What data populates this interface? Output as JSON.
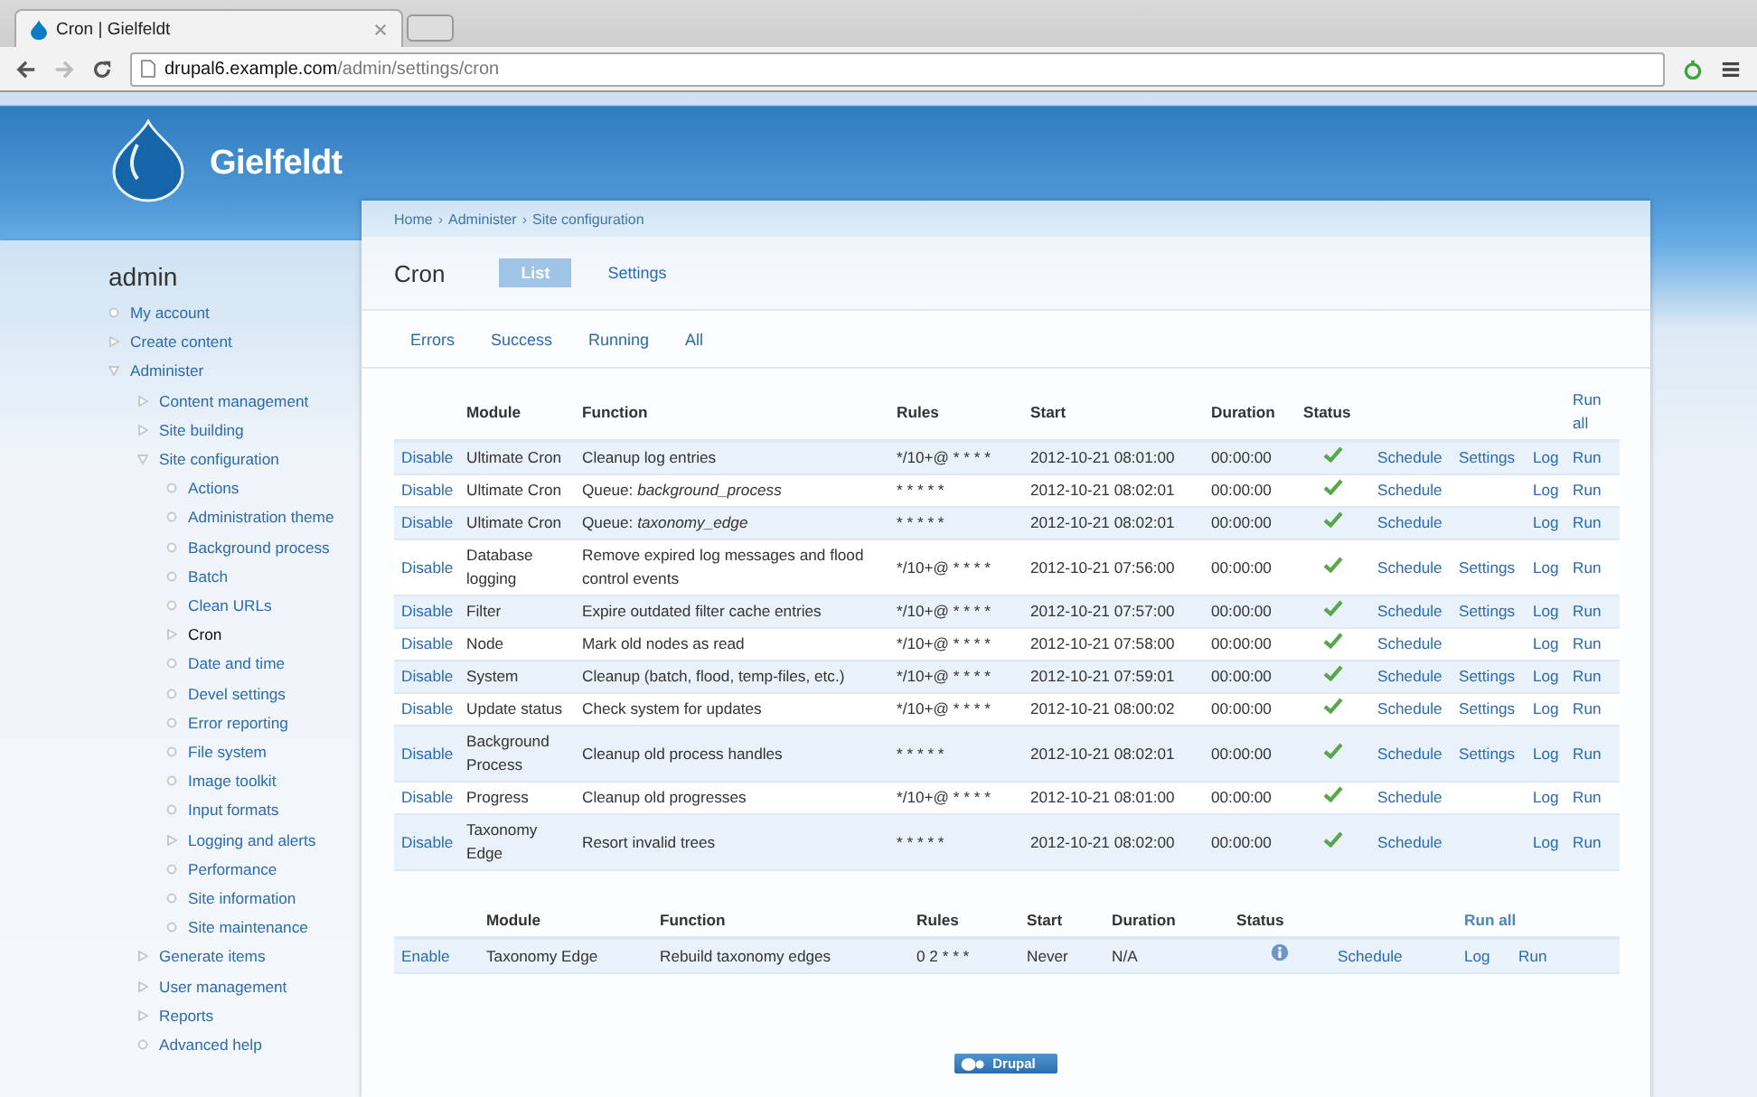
{
  "browser": {
    "tab_title": "Cron | Gielfeldt",
    "url_host": "drupal6.example.com",
    "url_path": "/admin/settings/cron"
  },
  "site_name": "Gielfeldt",
  "breadcrumb": {
    "separator": "›",
    "items": [
      "Home",
      "Administer",
      "Site configuration"
    ]
  },
  "sidebar": {
    "user": "admin",
    "items": [
      {
        "label": "My account",
        "kind": "leaf",
        "selected": false
      },
      {
        "label": "Create content",
        "kind": "branch",
        "expanded": false,
        "selected": false
      },
      {
        "label": "Administer",
        "kind": "branch",
        "expanded": true,
        "selected": false,
        "children": [
          {
            "label": "Content management",
            "kind": "branch",
            "expanded": false,
            "selected": false
          },
          {
            "label": "Site building",
            "kind": "branch",
            "expanded": false,
            "selected": false
          },
          {
            "label": "Site configuration",
            "kind": "branch",
            "expanded": true,
            "selected": false,
            "children": [
              {
                "label": "Actions",
                "kind": "leaf",
                "selected": false
              },
              {
                "label": "Administration theme",
                "kind": "leaf",
                "selected": false
              },
              {
                "label": "Background process",
                "kind": "leaf",
                "selected": false
              },
              {
                "label": "Batch",
                "kind": "leaf",
                "selected": false
              },
              {
                "label": "Clean URLs",
                "kind": "leaf",
                "selected": false
              },
              {
                "label": "Cron",
                "kind": "branch",
                "expanded": false,
                "selected": true
              },
              {
                "label": "Date and time",
                "kind": "leaf",
                "selected": false
              },
              {
                "label": "Devel settings",
                "kind": "leaf",
                "selected": false
              },
              {
                "label": "Error reporting",
                "kind": "leaf",
                "selected": false
              },
              {
                "label": "File system",
                "kind": "leaf",
                "selected": false
              },
              {
                "label": "Image toolkit",
                "kind": "leaf",
                "selected": false
              },
              {
                "label": "Input formats",
                "kind": "leaf",
                "selected": false
              },
              {
                "label": "Logging and alerts",
                "kind": "branch",
                "expanded": false,
                "selected": false
              },
              {
                "label": "Performance",
                "kind": "leaf",
                "selected": false
              },
              {
                "label": "Site information",
                "kind": "leaf",
                "selected": false
              },
              {
                "label": "Site maintenance",
                "kind": "leaf",
                "selected": false
              }
            ]
          },
          {
            "label": "Generate items",
            "kind": "branch",
            "expanded": false,
            "selected": false
          },
          {
            "label": "User management",
            "kind": "branch",
            "expanded": false,
            "selected": false
          },
          {
            "label": "Reports",
            "kind": "branch",
            "expanded": false,
            "selected": false
          },
          {
            "label": "Advanced help",
            "kind": "leaf",
            "selected": false
          }
        ]
      }
    ]
  },
  "page_title": "Cron",
  "tabs": [
    {
      "label": "List",
      "selected": true
    },
    {
      "label": "Settings",
      "selected": false
    }
  ],
  "subtabs": [
    {
      "label": "Errors",
      "selected": false
    },
    {
      "label": "Success",
      "selected": false
    },
    {
      "label": "Running",
      "selected": false
    },
    {
      "label": "All",
      "selected": false
    }
  ],
  "jobs_table": {
    "columns": [
      "Module",
      "Function",
      "Rules",
      "Start",
      "Duration",
      "Status"
    ],
    "run_all": "Run all",
    "rows": [
      {
        "action": "Disable",
        "module": "Ultimate Cron",
        "function": "Cleanup log entries",
        "rules": "*/10+@ * * * *",
        "start": "2012-10-21 08:01:00",
        "duration": "00:00:00",
        "kind": "ok",
        "schedule": "Schedule",
        "settings": "Settings",
        "log": "Log",
        "run": "Run"
      },
      {
        "action": "Disable",
        "module": "Ultimate Cron",
        "function": "Queue: *background_process*",
        "rules": "* * * * *",
        "start": "2012-10-21 08:02:01",
        "duration": "00:00:00",
        "kind": "ok",
        "schedule": "Schedule",
        "log": "Log",
        "run": "Run"
      },
      {
        "action": "Disable",
        "module": "Ultimate Cron",
        "function": "Queue: *taxonomy_edge*",
        "rules": "* * * * *",
        "start": "2012-10-21 08:02:01",
        "duration": "00:00:00",
        "kind": "ok",
        "schedule": "Schedule",
        "log": "Log",
        "run": "Run"
      },
      {
        "action": "Disable",
        "module": "Database logging",
        "function": "Remove expired log messages and flood control events",
        "rules": "*/10+@ * * * *",
        "start": "2012-10-21 07:56:00",
        "duration": "00:00:00",
        "kind": "ok",
        "schedule": "Schedule",
        "settings": "Settings",
        "log": "Log",
        "run": "Run"
      },
      {
        "action": "Disable",
        "module": "Filter",
        "function": "Expire outdated filter cache entries",
        "rules": "*/10+@ * * * *",
        "start": "2012-10-21 07:57:00",
        "duration": "00:00:00",
        "kind": "ok",
        "schedule": "Schedule",
        "settings": "Settings",
        "log": "Log",
        "run": "Run"
      },
      {
        "action": "Disable",
        "module": "Node",
        "function": "Mark old nodes as read",
        "rules": "*/10+@ * * * *",
        "start": "2012-10-21 07:58:00",
        "duration": "00:00:00",
        "kind": "ok",
        "schedule": "Schedule",
        "log": "Log",
        "run": "Run"
      },
      {
        "action": "Disable",
        "module": "System",
        "function": "Cleanup (batch, flood, temp-files, etc.)",
        "rules": "*/10+@ * * * *",
        "start": "2012-10-21 07:59:01",
        "duration": "00:00:00",
        "kind": "ok",
        "schedule": "Schedule",
        "settings": "Settings",
        "log": "Log",
        "run": "Run"
      },
      {
        "action": "Disable",
        "module": "Update status",
        "function": "Check system for updates",
        "rules": "*/10+@ * * * *",
        "start": "2012-10-21 08:00:02",
        "duration": "00:00:00",
        "kind": "ok",
        "schedule": "Schedule",
        "settings": "Settings",
        "log": "Log",
        "run": "Run"
      },
      {
        "action": "Disable",
        "module": "Background Process",
        "function": "Cleanup old process handles",
        "rules": "* * * * *",
        "start": "2012-10-21 08:02:01",
        "duration": "00:00:00",
        "kind": "ok",
        "schedule": "Schedule",
        "settings": "Settings",
        "log": "Log",
        "run": "Run"
      },
      {
        "action": "Disable",
        "module": "Progress",
        "function": "Cleanup old progresses",
        "rules": "*/10+@ * * * *",
        "start": "2012-10-21 08:01:00",
        "duration": "00:00:00",
        "kind": "ok",
        "schedule": "Schedule",
        "log": "Log",
        "run": "Run"
      },
      {
        "action": "Disable",
        "module": "Taxonomy Edge",
        "function": "Resort invalid trees",
        "rules": "* * * * *",
        "start": "2012-10-21 08:02:00",
        "duration": "00:00:00",
        "kind": "ok",
        "schedule": "Schedule",
        "log": "Log",
        "run": "Run"
      }
    ]
  },
  "disabled_table": {
    "columns": [
      "Module",
      "Function",
      "Rules",
      "Start",
      "Duration",
      "Status"
    ],
    "run_all": "Run all",
    "rows": [
      {
        "action": "Enable",
        "module": "Taxonomy Edge",
        "function": "Rebuild taxonomy edges",
        "rules": "0 2 * * *",
        "start": "Never",
        "duration": "N/A",
        "kind": "info",
        "schedule": "Schedule",
        "log": "Log",
        "run": "Run"
      }
    ]
  },
  "footer_badge": "Drupal"
}
